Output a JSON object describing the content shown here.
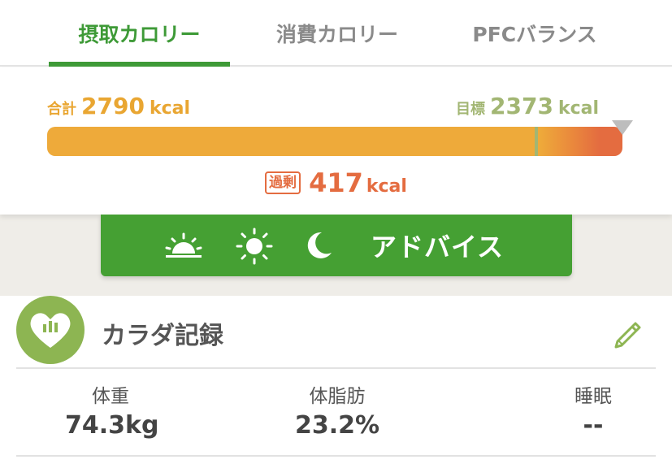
{
  "tabs": [
    {
      "label": "摂取カロリー",
      "active": true
    },
    {
      "label": "消費カロリー",
      "active": false
    },
    {
      "label": "PFCバランス",
      "active": false
    }
  ],
  "calories": {
    "total_label": "合計",
    "total_value": "2790",
    "target_label": "目標",
    "target_value": "2373",
    "unit": "kcal",
    "progress_fraction": 1.0,
    "target_fraction": 0.8505,
    "excess_label": "過剰",
    "excess_value": "417"
  },
  "advice": {
    "label": "アドバイス",
    "icons": [
      "sunrise-icon",
      "sun-icon",
      "moon-icon"
    ]
  },
  "body_record": {
    "title": "カラダ記録",
    "icon": "heart-chart-icon",
    "edit_icon": "pencil-icon",
    "metrics": [
      {
        "label": "体重",
        "value": "74.3kg"
      },
      {
        "label": "体脂肪",
        "value": "23.2%"
      },
      {
        "label": "睡眠",
        "value": "--"
      }
    ]
  },
  "colors": {
    "accent_green": "#3e9a37",
    "button_green": "#45a033",
    "total_orange": "#e9a632",
    "excess_red": "#e46c40",
    "target_olive": "#a2b673"
  }
}
